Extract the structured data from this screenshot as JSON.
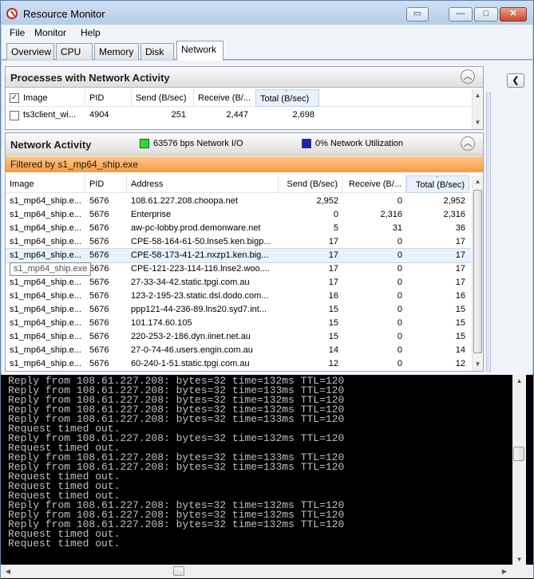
{
  "window": {
    "title": "Resource Monitor",
    "controls": {
      "restore": "▭",
      "minimize": "—",
      "maximize": "□",
      "close": "✕"
    }
  },
  "menu": [
    "File",
    "Monitor",
    "Help"
  ],
  "tabs": [
    "Overview",
    "CPU",
    "Memory",
    "Disk",
    "Network"
  ],
  "processes_panel": {
    "title": "Processes with Network Activity",
    "columns": [
      "Image",
      "PID",
      "Send (B/sec)",
      "Receive (B/...",
      "Total (B/sec)"
    ],
    "rows": [
      {
        "image": "ts3client_wi...",
        "pid": "4904",
        "send": "251",
        "receive": "2,447",
        "total": "2,698"
      }
    ]
  },
  "network_panel": {
    "title": "Network Activity",
    "legend1": "63576 bps Network I/O",
    "legend2": "0% Network Utilization",
    "legend1_color": "#1ee61e",
    "legend2_color": "#1f1fbf",
    "filter": "Filtered by s1_mp64_ship.exe",
    "columns": [
      "Image",
      "PID",
      "Address",
      "Send (B/sec)",
      "Receive (B/...",
      "Total (B/sec)"
    ],
    "tooltip": "s1_mp64_ship.exe",
    "rows": [
      {
        "image": "s1_mp64_ship.e...",
        "pid": "5676",
        "address": "108.61.227.208.choopa.net",
        "send": "2,952",
        "receive": "0",
        "total": "2,952"
      },
      {
        "image": "s1_mp64_ship.e...",
        "pid": "5676",
        "address": "Enterprise",
        "send": "0",
        "receive": "2,316",
        "total": "2,316"
      },
      {
        "image": "s1_mp64_ship.e...",
        "pid": "5676",
        "address": "aw-pc-lobby.prod.demonware.net",
        "send": "5",
        "receive": "31",
        "total": "36"
      },
      {
        "image": "s1_mp64_ship.e...",
        "pid": "5676",
        "address": "CPE-58-164-61-50.lnse5.ken.bigp...",
        "send": "17",
        "receive": "0",
        "total": "17"
      },
      {
        "image": "s1_mp64_ship.e...",
        "pid": "5676",
        "address": "CPE-58-173-41-21.nxzp1.ken.big...",
        "send": "17",
        "receive": "0",
        "total": "17"
      },
      {
        "image": "s1_mp64_ship.exe",
        "pid": "5676",
        "address": "CPE-121-223-114-116.lnse2.woo....",
        "send": "17",
        "receive": "0",
        "total": "17"
      },
      {
        "image": "s1_mp64_ship.e...",
        "pid": "5676",
        "address": "27-33-34-42.static.tpgi.com.au",
        "send": "17",
        "receive": "0",
        "total": "17"
      },
      {
        "image": "s1_mp64_ship.e...",
        "pid": "5676",
        "address": "123-2-195-23.static.dsl.dodo.com...",
        "send": "16",
        "receive": "0",
        "total": "16"
      },
      {
        "image": "s1_mp64_ship.e...",
        "pid": "5676",
        "address": "ppp121-44-236-89.lns20.syd7.int...",
        "send": "15",
        "receive": "0",
        "total": "15"
      },
      {
        "image": "s1_mp64_ship.e...",
        "pid": "5676",
        "address": "101.174.60.105",
        "send": "15",
        "receive": "0",
        "total": "15"
      },
      {
        "image": "s1_mp64_ship.e...",
        "pid": "5676",
        "address": "220-253-2-186.dyn.iinet.net.au",
        "send": "15",
        "receive": "0",
        "total": "15"
      },
      {
        "image": "s1_mp64_ship.e...",
        "pid": "5676",
        "address": "27-0-74-46.users.engin.com.au",
        "send": "14",
        "receive": "0",
        "total": "14"
      },
      {
        "image": "s1_mp64_ship.e...",
        "pid": "5676",
        "address": "60-240-1-51.static.tpgi.com.au",
        "send": "12",
        "receive": "0",
        "total": "12"
      }
    ]
  },
  "console": {
    "lines": [
      "Reply from 108.61.227.208: bytes=32 time=132ms TTL=120",
      "Reply from 108.61.227.208: bytes=32 time=133ms TTL=120",
      "Reply from 108.61.227.208: bytes=32 time=132ms TTL=120",
      "Reply from 108.61.227.208: bytes=32 time=132ms TTL=120",
      "Reply from 108.61.227.208: bytes=32 time=133ms TTL=120",
      "Request timed out.",
      "Reply from 108.61.227.208: bytes=32 time=132ms TTL=120",
      "Request timed out.",
      "Reply from 108.61.227.208: bytes=32 time=133ms TTL=120",
      "Reply from 108.61.227.208: bytes=32 time=133ms TTL=120",
      "Request timed out.",
      "Request timed out.",
      "Request timed out.",
      "Reply from 108.61.227.208: bytes=32 time=132ms TTL=120",
      "Reply from 108.61.227.208: bytes=32 time=132ms TTL=120",
      "Reply from 108.61.227.208: bytes=32 time=132ms TTL=120",
      "Request timed out.",
      "Request timed out."
    ]
  }
}
